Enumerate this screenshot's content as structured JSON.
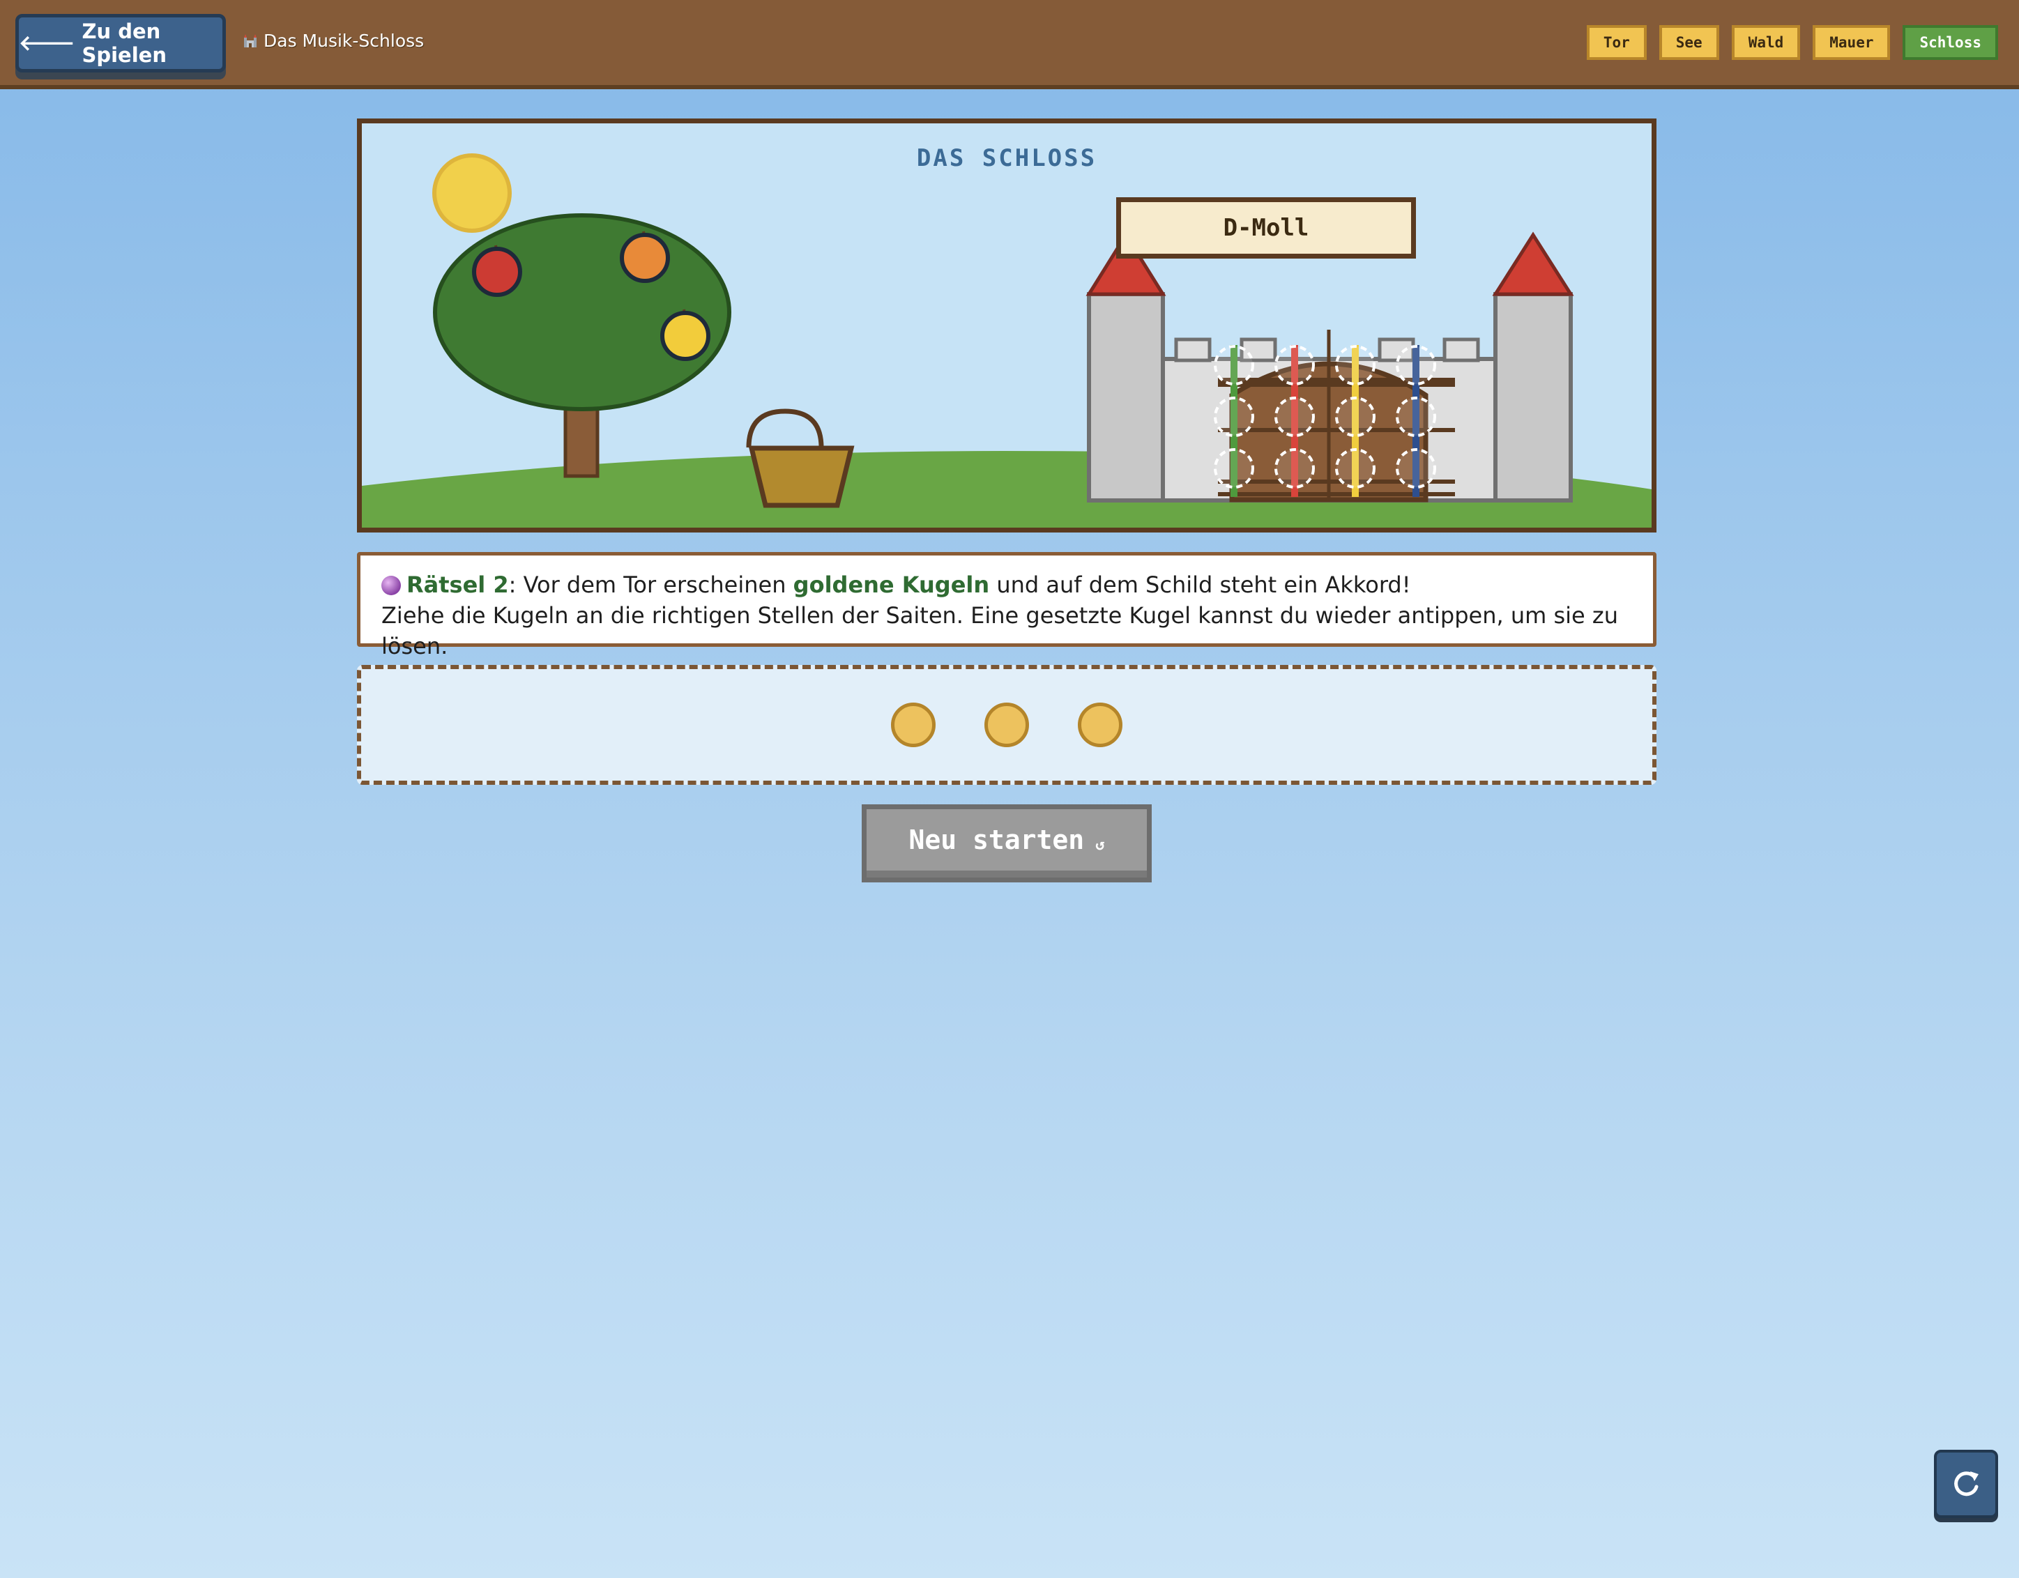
{
  "header": {
    "back_label": "Zu den Spielen",
    "back_icon": "arrow-left-icon",
    "title": "Das Musik-Schloss",
    "title_icon": "castle-icon",
    "nav": [
      {
        "label": "Tor",
        "active": false
      },
      {
        "label": "See",
        "active": false
      },
      {
        "label": "Wald",
        "active": false
      },
      {
        "label": "Mauer",
        "active": false
      },
      {
        "label": "Schloss",
        "active": true
      }
    ]
  },
  "scene": {
    "title": "DAS SCHLOSS",
    "chord": "D-Moll",
    "string_colors": [
      "#4f9a3d",
      "#d9443b",
      "#f0cd3e",
      "#2e4f8e"
    ],
    "fruit_colors": [
      "#cc3b33",
      "#e88a39",
      "#f2cc3b"
    ]
  },
  "instruction": {
    "icon": "crystal-orb-icon",
    "riddle": "Rätsel 2",
    "part1": ": Vor dem Tor erscheinen ",
    "highlight": "goldene Kugeln",
    "part2": " und auf dem Schild steht ein Akkord!",
    "line2": "Ziehe die Kugeln an die richtigen Stellen der Saiten. Eine gesetzte Kugel kannst du wieder antippen, um sie zu lösen."
  },
  "tray": {
    "ball_count": 3
  },
  "restart": {
    "label": "Neu starten",
    "glyph": "↺"
  },
  "reload": {
    "icon": "reload-icon"
  },
  "colors": {
    "header_bg": "#855b38",
    "accent_blue": "#3d628c",
    "nav_bg": "#f1c452",
    "nav_active": "#5fa046",
    "highlight_green": "#2f6b32"
  }
}
